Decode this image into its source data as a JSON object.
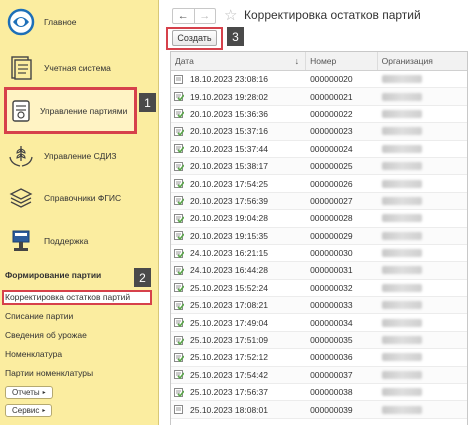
{
  "sidebar": {
    "items": [
      {
        "label": "Главное",
        "icon": "home-logo-icon"
      },
      {
        "label": "Учетная система",
        "icon": "document-list-icon"
      },
      {
        "label": "Управление партиями",
        "icon": "batch-scroll-icon"
      },
      {
        "label": "Управление СДИЗ",
        "icon": "wheat-hands-icon"
      },
      {
        "label": "Справочники ФГИС",
        "icon": "layers-icon"
      },
      {
        "label": "Поддержка",
        "icon": "support-terminal-icon"
      }
    ],
    "section_title": "Формирование партии",
    "links": [
      "Корректировка остатков партий",
      "Списание партии",
      "Сведения об урожае",
      "Номенклатура",
      "Партии номенклатуры"
    ],
    "reports_button": "Отчеты",
    "service_button": "Сервис"
  },
  "badges": [
    "1",
    "2",
    "3"
  ],
  "main": {
    "title": "Корректировка остатков партий",
    "create_button": "Создать",
    "columns": {
      "date": "Дата",
      "number": "Номер",
      "organization": "Организация"
    },
    "rows": [
      {
        "date": "18.10.2023 23:08:16",
        "number": "000000020",
        "posted": false
      },
      {
        "date": "19.10.2023 19:28:02",
        "number": "000000021",
        "posted": true
      },
      {
        "date": "20.10.2023 15:36:36",
        "number": "000000022",
        "posted": true
      },
      {
        "date": "20.10.2023 15:37:16",
        "number": "000000023",
        "posted": true
      },
      {
        "date": "20.10.2023 15:37:44",
        "number": "000000024",
        "posted": true
      },
      {
        "date": "20.10.2023 15:38:17",
        "number": "000000025",
        "posted": true
      },
      {
        "date": "20.10.2023 17:54:25",
        "number": "000000026",
        "posted": true
      },
      {
        "date": "20.10.2023 17:56:39",
        "number": "000000027",
        "posted": true
      },
      {
        "date": "20.10.2023 19:04:28",
        "number": "000000028",
        "posted": true
      },
      {
        "date": "20.10.2023 19:15:35",
        "number": "000000029",
        "posted": true
      },
      {
        "date": "24.10.2023 16:21:15",
        "number": "000000030",
        "posted": true
      },
      {
        "date": "24.10.2023 16:44:28",
        "number": "000000031",
        "posted": true
      },
      {
        "date": "25.10.2023 15:52:24",
        "number": "000000032",
        "posted": true
      },
      {
        "date": "25.10.2023 17:08:21",
        "number": "000000033",
        "posted": true
      },
      {
        "date": "25.10.2023 17:49:04",
        "number": "000000034",
        "posted": true
      },
      {
        "date": "25.10.2023 17:51:09",
        "number": "000000035",
        "posted": true
      },
      {
        "date": "25.10.2023 17:52:12",
        "number": "000000036",
        "posted": true
      },
      {
        "date": "25.10.2023 17:54:42",
        "number": "000000037",
        "posted": true
      },
      {
        "date": "25.10.2023 17:56:37",
        "number": "000000038",
        "posted": true
      },
      {
        "date": "25.10.2023 18:08:01",
        "number": "000000039",
        "posted": false
      }
    ]
  },
  "colors": {
    "sidebar_bg": "#fbeda0",
    "highlight_red": "#d6414b",
    "badge_bg": "#4a4a4a",
    "posted_green": "#5aa64a"
  }
}
